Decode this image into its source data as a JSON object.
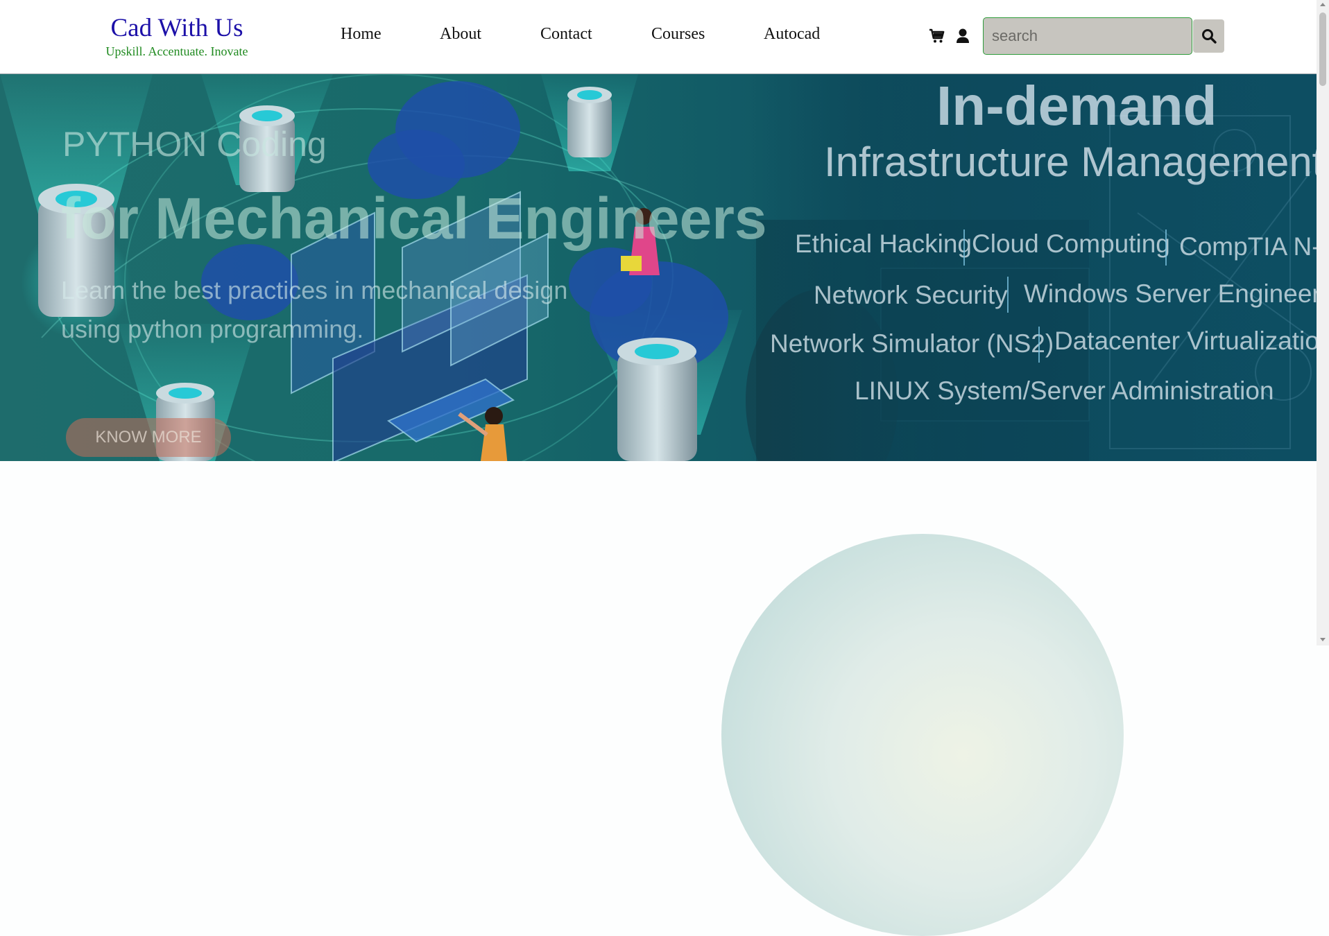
{
  "brand": {
    "title": "Cad With Us",
    "tagline": "Upskill. Accentuate. Inovate"
  },
  "nav": {
    "items": [
      {
        "label": "Home"
      },
      {
        "label": "About"
      },
      {
        "label": "Contact"
      },
      {
        "label": "Courses"
      },
      {
        "label": "Autocad"
      }
    ]
  },
  "header_icons": {
    "cart": "cart-icon",
    "user": "user-icon",
    "search": "search-icon"
  },
  "search": {
    "placeholder": "search",
    "value": ""
  },
  "hero": {
    "slide": {
      "line1": "PYTHON Coding",
      "line2": "for Mechanical Engineers",
      "description": "Learn the best practices in mechanical design using python programming.",
      "button": "KNOW MORE"
    },
    "ad": {
      "headline": "In-demand",
      "subheadline": "Infrastructure Management",
      "tags": [
        "Ethical Hacking",
        "Cloud Computing",
        "CompTIA N-",
        "Network Security",
        "Windows Server Engineer",
        "Network Simulator (NS2)",
        "Datacenter Virtualization",
        "LINUX System/Server Administration"
      ]
    }
  },
  "colors": {
    "brand_title": "#1c10a8",
    "brand_tagline": "#1f8a1f",
    "search_border": "#2e9c3a",
    "search_bg": "#c7c5bf",
    "hero_bg": "#176a6a"
  }
}
